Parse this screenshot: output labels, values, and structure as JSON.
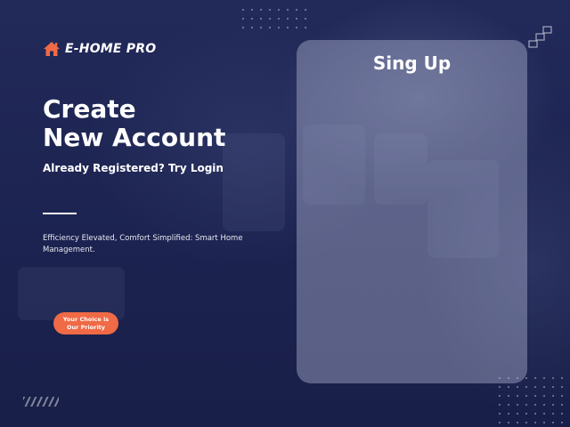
{
  "brand": {
    "name": "E-HOME PRO",
    "icon": "home-icon",
    "icon_color": "#ef6a45"
  },
  "heading": {
    "line1": "Create",
    "line2": "New Account"
  },
  "login_prompt": "Already Registered? Try Login",
  "tagline": "Efficiency Elevated, Comfort Simplified: Smart Home Management.",
  "badge": {
    "line1": "Your Choice is",
    "line2": "Our Priority",
    "color": "#ef6a45"
  },
  "signup_card": {
    "title": "Sing Up"
  },
  "colors": {
    "background": "#1c2350",
    "accent": "#ef6a45",
    "text": "#ffffff"
  }
}
